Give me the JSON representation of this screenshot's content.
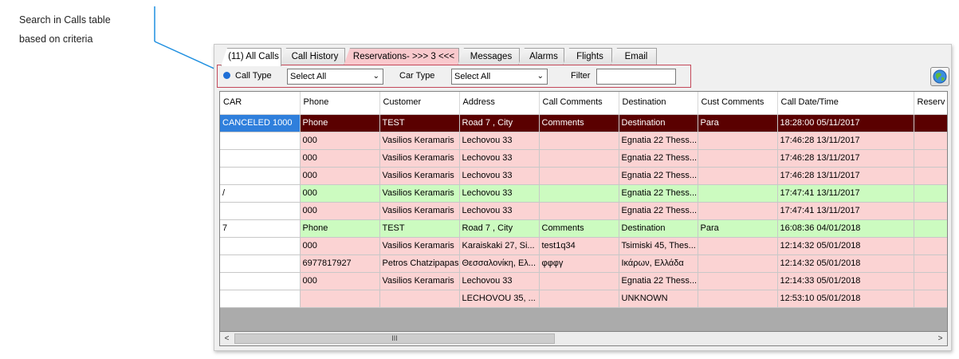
{
  "callout": {
    "text_line1": "Search in Calls table",
    "text_line2": "based on criteria"
  },
  "tabs": [
    {
      "label": "(11) All Calls"
    },
    {
      "label": "Call History"
    },
    {
      "label": "Reservations- >>> 3 <<<"
    },
    {
      "label": "Messages"
    },
    {
      "label": "Alarms"
    },
    {
      "label": "Flights"
    },
    {
      "label": "Email"
    }
  ],
  "filters": {
    "call_type_label": "Call Type",
    "call_type_value": "Select All",
    "car_type_label": "Car Type",
    "car_type_value": "Select All",
    "filter_label": "Filter",
    "filter_value": ""
  },
  "colors": {
    "selected_row": "#5a0000",
    "pink_row": "#fbd3d3",
    "green_row": "#ccfbc0",
    "selected_cell": "#2f7fdc",
    "reservation_tab": "#f9c9cd"
  },
  "table": {
    "columns": [
      "CAR",
      "Phone",
      "Customer",
      "Address",
      "Call Comments",
      "Destination",
      "Cust Comments",
      "Call Date/Time",
      "Reserv"
    ],
    "rows": [
      {
        "style": "sel",
        "cells": [
          "CANCELED 1000",
          "Phone",
          "TEST",
          "Road 7 , City",
          "Comments",
          "Destination",
          "Para",
          "18:28:00 05/11/2017",
          ""
        ]
      },
      {
        "style": "pink",
        "cells": [
          "",
          "000",
          "Vasilios Keramaris",
          "Lechovou 33",
          "",
          "Egnatia 22 Thess...",
          "",
          "17:46:28 13/11/2017",
          ""
        ]
      },
      {
        "style": "pink",
        "cells": [
          "",
          "000",
          "Vasilios Keramaris",
          "Lechovou 33",
          "",
          "Egnatia 22 Thess...",
          "",
          "17:46:28 13/11/2017",
          ""
        ]
      },
      {
        "style": "pink",
        "cells": [
          "",
          "000",
          "Vasilios Keramaris",
          "Lechovou 33",
          "",
          "Egnatia 22 Thess...",
          "",
          "17:46:28 13/11/2017",
          ""
        ]
      },
      {
        "style": "green",
        "cells": [
          "/",
          "000",
          "Vasilios Keramaris",
          "Lechovou 33",
          "",
          "Egnatia 22 Thess...",
          "",
          "17:47:41 13/11/2017",
          ""
        ]
      },
      {
        "style": "pink",
        "cells": [
          "",
          "000",
          "Vasilios Keramaris",
          "Lechovou 33",
          "",
          "Egnatia 22 Thess...",
          "",
          "17:47:41 13/11/2017",
          ""
        ]
      },
      {
        "style": "green",
        "cells": [
          "7",
          "Phone",
          "TEST",
          "Road 7 , City",
          "Comments",
          "Destination",
          "Para",
          "16:08:36 04/01/2018",
          ""
        ]
      },
      {
        "style": "pink",
        "cells": [
          "",
          "000",
          "Vasilios Keramaris",
          "Karaiskaki 27, Si...",
          "test1q34",
          "Tsimiski 45, Thes...",
          "",
          "12:14:32 05/01/2018",
          ""
        ]
      },
      {
        "style": "pink",
        "cells": [
          "",
          "6977817927",
          "Petros Chatzipapas",
          "Θεσσαλονίκη, Ελ...",
          "φφφγ",
          "Ικάρων, Ελλάδα",
          "",
          "12:14:32 05/01/2018",
          ""
        ]
      },
      {
        "style": "pink",
        "cells": [
          "",
          "000",
          "Vasilios Keramaris",
          "Lechovou 33",
          "",
          "Egnatia 22 Thess...",
          "",
          "12:14:33 05/01/2018",
          ""
        ]
      },
      {
        "style": "pink",
        "cells": [
          "",
          "",
          "",
          "LECHOVOU 35, ...",
          "",
          "UNKNOWN",
          "",
          "12:53:10 05/01/2018",
          ""
        ]
      }
    ]
  },
  "scrollbar": {
    "left_arrow": "<",
    "right_arrow": ">",
    "thumb_grip": "III"
  }
}
